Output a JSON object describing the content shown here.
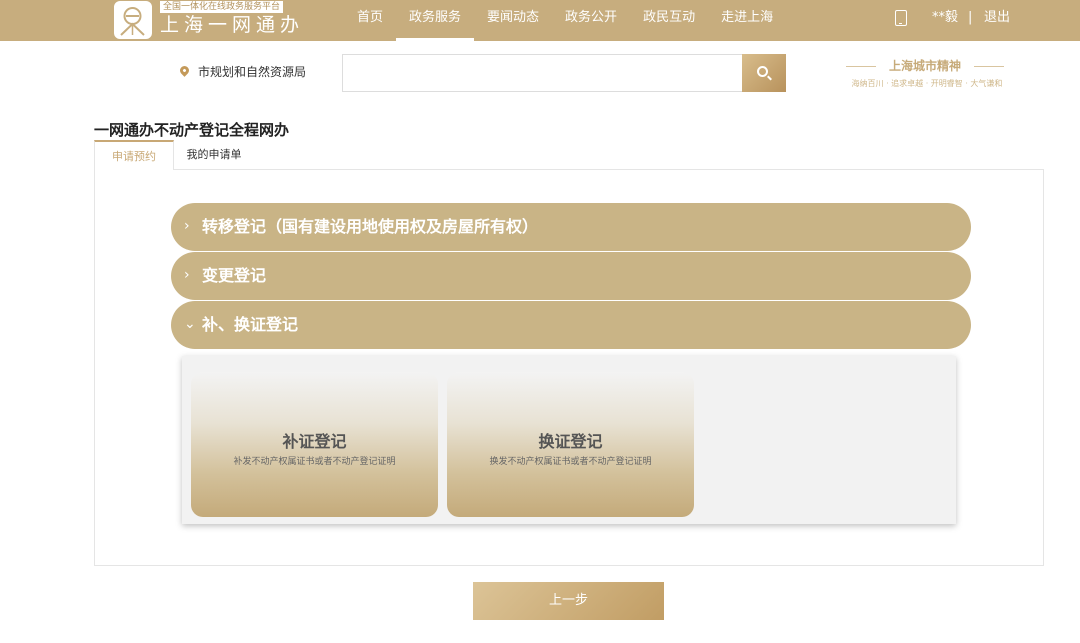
{
  "header": {
    "logo_tagline": "全国一体化在线政务服务平台",
    "logo_text": "上海一网通办",
    "nav": [
      "首页",
      "政务服务",
      "要闻动态",
      "政务公开",
      "政民互动",
      "走进上海"
    ],
    "active_nav_index": 1,
    "user_name": "**毅",
    "separator": "|",
    "logout_label": "退出"
  },
  "search": {
    "location_label": "市规划和自然资源局",
    "placeholder": "",
    "spirit_title": "上海城市精神",
    "spirit_subtitle": "海纳百川 · 追求卓越 · 开明睿智 · 大气谦和"
  },
  "page": {
    "title": "一网通办不动产登记全程网办",
    "tabs": [
      {
        "label": "申请预约",
        "active": true
      },
      {
        "label": "我的申请单",
        "active": false
      }
    ]
  },
  "accordion": [
    {
      "arrow": "›",
      "label": "转移登记（国有建设用地使用权及房屋所有权）",
      "expanded": false
    },
    {
      "arrow": "›",
      "label": "变更登记",
      "expanded": false
    },
    {
      "arrow": "⌄",
      "label": "补、换证登记",
      "expanded": true
    }
  ],
  "cards": [
    {
      "title": "补证登记",
      "description": "补发不动产权属证书或者不动产登记证明"
    },
    {
      "title": "换证登记",
      "description": "换发不动产权属证书或者不动产登记证明"
    }
  ],
  "footer": {
    "prev_button": "上一步"
  },
  "colors": {
    "header_bg": "#c7ad7e",
    "accordion_bg": "#c9b486",
    "accent": "#c8a875"
  }
}
